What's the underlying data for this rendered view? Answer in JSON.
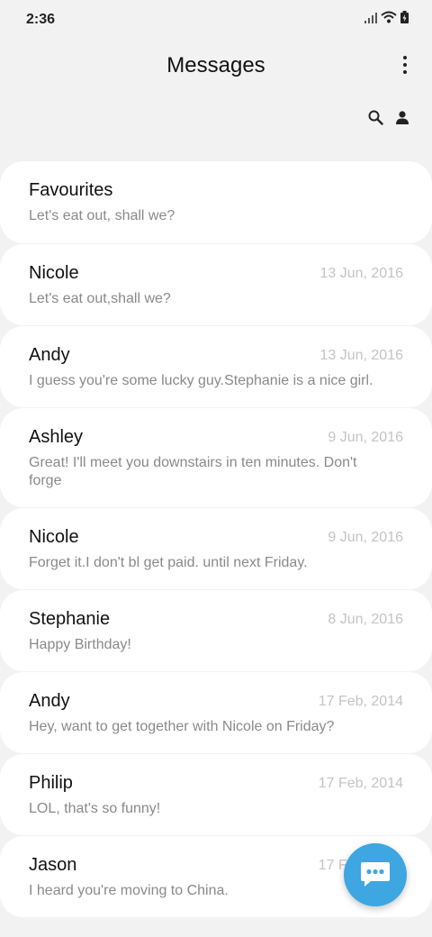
{
  "status_bar": {
    "time": "2:36"
  },
  "header": {
    "title": "Messages"
  },
  "actions": {
    "search_icon": "search-icon",
    "contacts_icon": "person-icon",
    "more_icon": "more-vert-icon"
  },
  "conversations": [
    {
      "name": "Favourites",
      "date": "",
      "preview": "Let's eat out, shall we?"
    },
    {
      "name": "Nicole",
      "date": "13 Jun, 2016",
      "preview": "Let's eat out,shall we?"
    },
    {
      "name": "Andy",
      "date": "13 Jun, 2016",
      "preview": "I guess you're some lucky guy.Stephanie is a nice girl."
    },
    {
      "name": "Ashley",
      "date": "9 Jun, 2016",
      "preview": "Great! I'll meet you downstairs in ten minutes. Don't forge"
    },
    {
      "name": "Nicole",
      "date": "9 Jun, 2016",
      "preview": "Forget it.I don't bl get paid. until next Friday."
    },
    {
      "name": "Stephanie",
      "date": "8 Jun, 2016",
      "preview": "Happy Birthday!"
    },
    {
      "name": "Andy",
      "date": "17 Feb, 2014",
      "preview": "Hey, want to get together with Nicole on Friday?"
    },
    {
      "name": "Philip",
      "date": "17 Feb, 2014",
      "preview": "LOL, that's so funny!"
    },
    {
      "name": "Jason",
      "date": "17 Feb, 2014",
      "preview": "I heard you're moving to China."
    }
  ],
  "fab": {
    "icon": "new-message-icon",
    "color": "#3ea6e0"
  }
}
